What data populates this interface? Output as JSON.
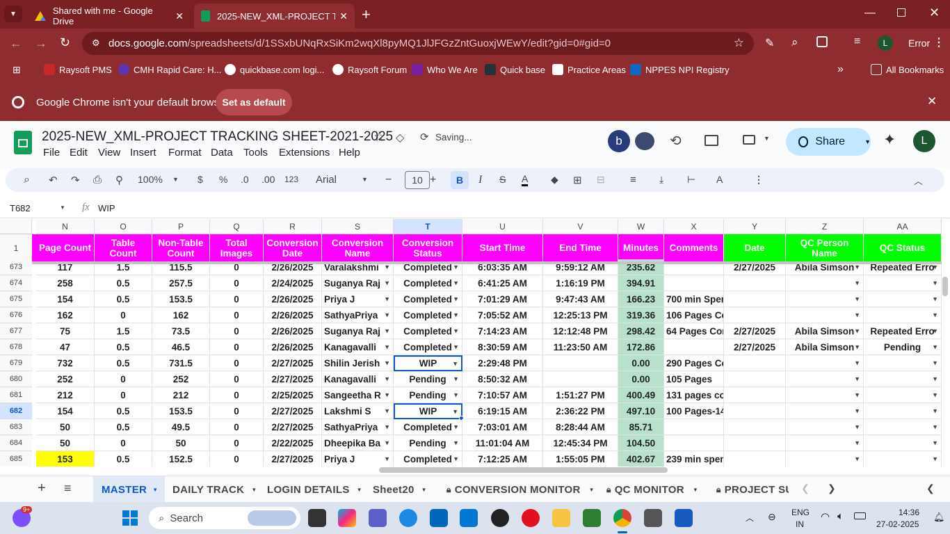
{
  "browser": {
    "tabs": [
      {
        "title": "Shared with me - Google Drive",
        "icon": "google-drive-icon"
      },
      {
        "title": "2025-NEW_XML-PROJECT TRAC",
        "icon": "google-sheets-icon"
      }
    ],
    "url_host": "docs.google.com",
    "url_path": "/spreadsheets/d/1SSxbUNqRxSiKm2wqXl8pyMQ1JlJFGzZntGuoxjWEwY/edit?gid=0#gid=0",
    "profile_initial": "L",
    "error_label": "Error",
    "bookmarks": [
      {
        "label": "Raysoft PMS",
        "color": "#c62828"
      },
      {
        "label": "CMH Rapid Care: H...",
        "color": "#5e35b1"
      },
      {
        "label": "quickbase.com logi...",
        "color": "#ffffff"
      },
      {
        "label": "Raysoft Forum",
        "color": "#ffffff"
      },
      {
        "label": "Who We Are",
        "color": "#7b1fa2"
      },
      {
        "label": "Quick base",
        "color": "#263238"
      },
      {
        "label": "Practice Areas",
        "color": "#ffffff"
      },
      {
        "label": "NPPES NPI Registry",
        "color": "#1565c0"
      }
    ],
    "all_bookmarks": "All Bookmarks"
  },
  "notice": {
    "text": "Google Chrome isn't your default browser",
    "button": "Set as default"
  },
  "sheet": {
    "title": "2025-NEW_XML-PROJECT TRACKING SHEET-2021-2025",
    "saving": "Saving...",
    "menus": [
      "File",
      "Edit",
      "View",
      "Insert",
      "Format",
      "Data",
      "Tools",
      "Extensions",
      "Help"
    ],
    "avatar_b": "b",
    "share": "Share",
    "user_initial": "L",
    "toolbar": {
      "zoom": "100%",
      "currency": "$",
      "percent": "%",
      "dec_less": ".0",
      "dec_more": ".00",
      "fmt123": "123",
      "font": "Arial",
      "font_size": "10"
    },
    "name_box": "T682",
    "formula": "WIP"
  },
  "grid": {
    "columns": [
      "N",
      "O",
      "P",
      "Q",
      "R",
      "S",
      "T",
      "U",
      "V",
      "W",
      "X",
      "Y",
      "Z",
      "AA"
    ],
    "header_row_num": "1",
    "headers": [
      "Page Count",
      "Table Count",
      "Non-Table Count",
      "Total Images",
      "Conversion Date",
      "Conversion Name",
      "Conversion Status",
      "Start Time",
      "End Time",
      "Minutes",
      "Comments",
      "Date",
      "QC Person Name",
      "QC Status"
    ],
    "rows": [
      {
        "num": "673",
        "cells": [
          "117",
          "1.5",
          "115.5",
          "0",
          "2/26/2025",
          "Varalakshmi",
          "Completed",
          "6:03:35 AM",
          "9:59:12 AM",
          "235.62",
          "",
          "2/27/2025",
          "Abila Simson",
          "Repeated Erro"
        ]
      },
      {
        "num": "674",
        "cells": [
          "258",
          "0.5",
          "257.5",
          "0",
          "2/24/2025",
          "Suganya Raj",
          "Completed",
          "6:41:25 AM",
          "1:16:19 PM",
          "394.91",
          "",
          "",
          "",
          ""
        ]
      },
      {
        "num": "675",
        "cells": [
          "154",
          "0.5",
          "153.5",
          "0",
          "2/26/2025",
          "Priya J",
          "Completed",
          "7:01:29 AM",
          "9:47:43 AM",
          "166.23",
          "700 min Sper",
          "",
          "",
          ""
        ]
      },
      {
        "num": "676",
        "cells": [
          "162",
          "0",
          "162",
          "0",
          "2/26/2025",
          "SathyaPriya",
          "Completed",
          "7:05:52 AM",
          "12:25:13 PM",
          "319.36",
          "106 Pages Co",
          "",
          "",
          ""
        ]
      },
      {
        "num": "677",
        "cells": [
          "75",
          "1.5",
          "73.5",
          "0",
          "2/26/2025",
          "Suganya Raj",
          "Completed",
          "7:14:23 AM",
          "12:12:48 PM",
          "298.42",
          "64 Pages Cor",
          "2/27/2025",
          "Abila Simson",
          "Repeated Erro"
        ]
      },
      {
        "num": "678",
        "cells": [
          "47",
          "0.5",
          "46.5",
          "0",
          "2/26/2025",
          "Kanagavalli",
          "Completed",
          "8:30:59 AM",
          "11:23:50 AM",
          "172.86",
          "",
          "2/27/2025",
          "Abila Simson",
          "Pending"
        ]
      },
      {
        "num": "679",
        "cells": [
          "732",
          "0.5",
          "731.5",
          "0",
          "2/27/2025",
          "Shilin Jerish",
          "WIP",
          "2:29:48 PM",
          "",
          "0.00",
          "290 Pages Co",
          "",
          "",
          ""
        ]
      },
      {
        "num": "680",
        "cells": [
          "252",
          "0",
          "252",
          "0",
          "2/27/2025",
          "Kanagavalli",
          "Pending",
          "8:50:32 AM",
          "",
          "0.00",
          "105 Pages",
          "",
          "",
          ""
        ]
      },
      {
        "num": "681",
        "cells": [
          "212",
          "0",
          "212",
          "0",
          "2/25/2025",
          "Sangeetha R",
          "Pending",
          "7:10:57 AM",
          "1:51:27 PM",
          "400.49",
          "131 pages co",
          "",
          "",
          ""
        ]
      },
      {
        "num": "682",
        "cells": [
          "154",
          "0.5",
          "153.5",
          "0",
          "2/27/2025",
          "Lakshmi S",
          "WIP",
          "6:19:15 AM",
          "2:36:22 PM",
          "497.10",
          "100 Pages-14",
          "",
          "",
          ""
        ]
      },
      {
        "num": "683",
        "cells": [
          "50",
          "0.5",
          "49.5",
          "0",
          "2/27/2025",
          "SathyaPriya",
          "Completed",
          "7:03:01 AM",
          "8:28:44 AM",
          "85.71",
          "",
          "",
          "",
          ""
        ]
      },
      {
        "num": "684",
        "cells": [
          "50",
          "0",
          "50",
          "0",
          "2/22/2025",
          "Dheepika Ba",
          "Pending",
          "11:01:04 AM",
          "12:45:34 PM",
          "104.50",
          "",
          "",
          "",
          ""
        ]
      },
      {
        "num": "685",
        "cells": [
          "153",
          "0.5",
          "152.5",
          "0",
          "2/27/2025",
          "Priya J",
          "Completed",
          "7:12:25 AM",
          "1:55:05 PM",
          "402.67",
          "239 min spen",
          "",
          "",
          ""
        ]
      }
    ]
  },
  "sheet_tabs": [
    {
      "label": "MASTER",
      "locked": false,
      "active": true
    },
    {
      "label": "DAILY TRACK",
      "locked": false
    },
    {
      "label": "LOGIN DETAILS",
      "locked": false
    },
    {
      "label": "Sheet20",
      "locked": false
    },
    {
      "label": "CONVERSION MONITOR",
      "locked": true
    },
    {
      "label": "QC MONITOR",
      "locked": true
    },
    {
      "label": "PROJECT SU",
      "locked": true
    }
  ],
  "taskbar": {
    "search": "Search",
    "notification_badge": "9+",
    "lang_top": "ENG",
    "lang_bottom": "IN",
    "time": "14:36",
    "date": "27-02-2025"
  },
  "colors": {
    "header_magenta": "#ff00ff",
    "header_green": "#00ff00",
    "minutes_green": "#b7e1cd",
    "highlight_yellow": "#ffff00",
    "chrome_red": "#8f2c30"
  }
}
